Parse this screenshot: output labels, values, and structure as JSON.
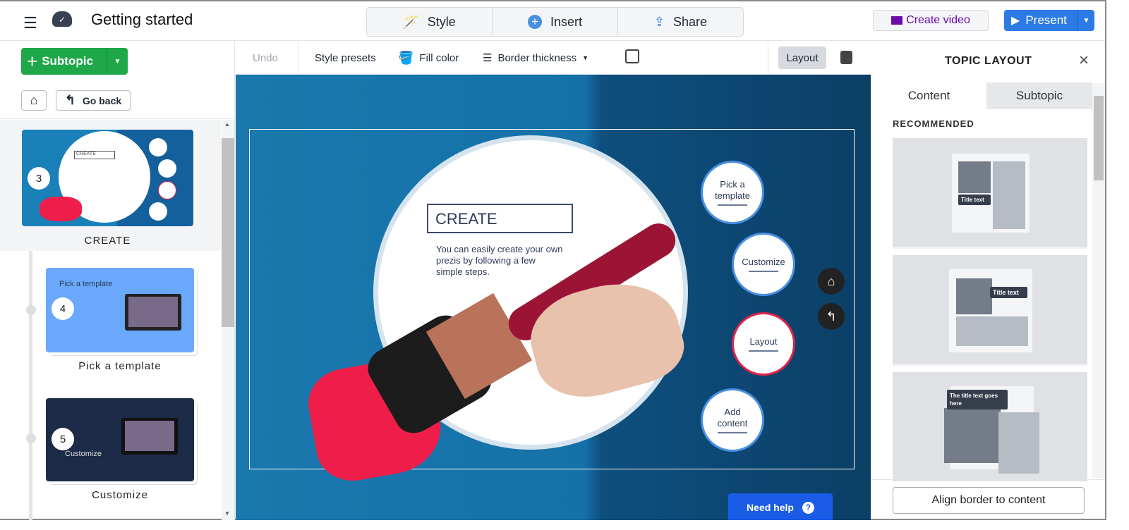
{
  "header": {
    "title": "Getting started",
    "menu_icon": "hamburger-icon",
    "cloud_icon": "cloud-saved-icon",
    "style": "Style",
    "insert": "Insert",
    "share": "Share",
    "create_video": "Create video",
    "present": "Present"
  },
  "toolbar": {
    "undo": "Undo",
    "style_presets": "Style presets",
    "fill_color": "Fill color",
    "border_thickness": "Border thickness",
    "layout": "Layout"
  },
  "left": {
    "subtopic": "Subtopic",
    "go_back": "Go back",
    "items": [
      {
        "number": "3",
        "label": "CREATE",
        "mini_title": "CREATE"
      },
      {
        "number": "4",
        "label": "Pick a template",
        "mini_title": "Pick a template"
      },
      {
        "number": "5",
        "label": "Customize",
        "mini_title": "Customize"
      }
    ]
  },
  "canvas": {
    "title": "CREATE",
    "body": "You can easily create your own prezis by following a few simple steps.",
    "bubbles": [
      "Pick a template",
      "Customize",
      "Layout",
      "Add content"
    ],
    "need_help": "Need help"
  },
  "right": {
    "title": "TOPIC LAYOUT",
    "tabs": [
      "Content",
      "Subtopic"
    ],
    "active_tab": "Content",
    "recommended": "RECOMMENDED",
    "layouts": [
      "Title text",
      "Title text",
      "The title text goes here"
    ],
    "align": "Align border to content"
  },
  "colors": {
    "green": "#1fa84a",
    "blue": "#2c7be5",
    "purple": "#6a0dad",
    "active_bubble": "#e0244a"
  }
}
